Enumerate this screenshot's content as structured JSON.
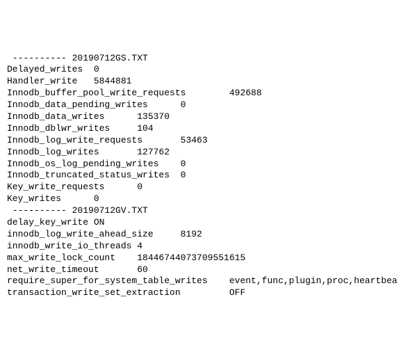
{
  "files": [
    {
      "separator": "----------",
      "name": "20190712GS.TXT",
      "rows": [
        {
          "key": "Delayed_writes",
          "value": "0",
          "pad": 2
        },
        {
          "key": "Handler_write",
          "value": "5844881",
          "pad": 3
        },
        {
          "key": "Innodb_buffer_pool_write_requests",
          "value": "492688",
          "pad": 8
        },
        {
          "key": "Innodb_data_pending_writes",
          "value": "0",
          "pad": 6
        },
        {
          "key": "Innodb_data_writes",
          "value": "135370",
          "pad": 6
        },
        {
          "key": "Innodb_dblwr_writes",
          "value": "104",
          "pad": 5
        },
        {
          "key": "Innodb_log_write_requests",
          "value": "53463",
          "pad": 7
        },
        {
          "key": "Innodb_log_writes",
          "value": "127762",
          "pad": 7
        },
        {
          "key": "Innodb_os_log_pending_writes",
          "value": "0",
          "pad": 4
        },
        {
          "key": "Innodb_truncated_status_writes",
          "value": "0",
          "pad": 2
        },
        {
          "key": "Key_write_requests",
          "value": "0",
          "pad": 6
        },
        {
          "key": "Key_writes",
          "value": "0",
          "pad": 6
        }
      ]
    },
    {
      "separator": "----------",
      "name": "20190712GV.TXT",
      "rows": [
        {
          "key": "delay_key_write",
          "value": "ON",
          "pad": 1
        },
        {
          "key": "innodb_log_write_ahead_size",
          "value": "8192",
          "pad": 5
        },
        {
          "key": "innodb_write_io_threads",
          "value": "4",
          "pad": 1
        },
        {
          "key": "max_write_lock_count",
          "value": "18446744073709551615",
          "pad": 4
        },
        {
          "key": "net_write_timeout",
          "value": "60",
          "pad": 7
        },
        {
          "key": "require_super_for_system_table_writes",
          "value": "event,func,plugin,proc,heartbea",
          "pad": 4
        },
        {
          "key": "transaction_write_set_extraction",
          "value": "OFF",
          "pad": 9
        }
      ]
    }
  ]
}
